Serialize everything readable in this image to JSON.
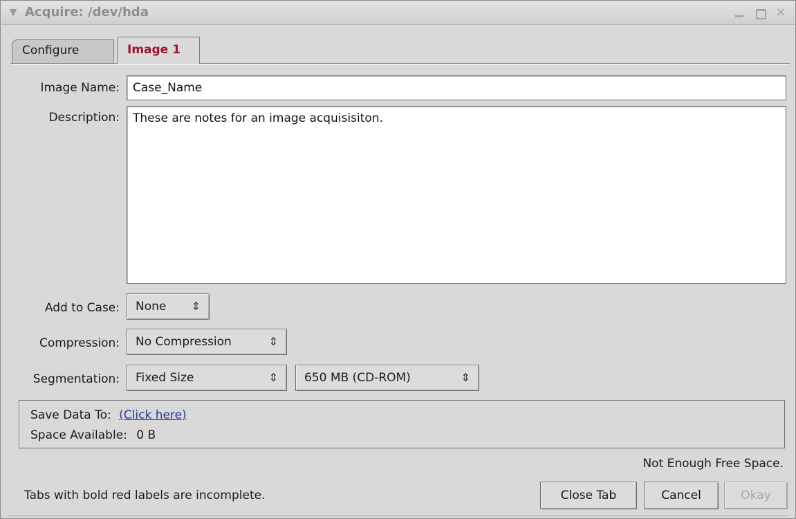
{
  "window": {
    "title": "Acquire: /dev/hda",
    "icons": {
      "menu": "chevron-down-icon",
      "minimize": "minimize-icon",
      "maximize": "maximize-icon",
      "close": "close-icon"
    },
    "close_glyph": "✕"
  },
  "tabs": [
    {
      "label": "Configure",
      "active": false
    },
    {
      "label": "Image 1",
      "active": true,
      "incomplete": true,
      "label_color": "#a0122a"
    }
  ],
  "form": {
    "image_name_label": "Image Name:",
    "image_name_value": "Case_Name",
    "description_label": "Description:",
    "description_value": "These are notes for an image acquisisiton.",
    "add_to_case_label": "Add to Case:",
    "add_to_case_value": "None",
    "compression_label": "Compression:",
    "compression_value": "No Compression",
    "segmentation_label": "Segmentation:",
    "segmentation_value": "Fixed Size",
    "segment_size_value": "650 MB (CD-ROM)",
    "select_arrow_glyph": "⇕"
  },
  "save": {
    "save_data_to_label": "Save Data To:",
    "save_link_text": "(Click here)",
    "space_available_label": "Space Available:",
    "space_available_value": "0 B"
  },
  "status": {
    "warning": "Not Enough Free Space.",
    "hint": "Tabs with bold red labels are incomplete."
  },
  "buttons": {
    "close_tab": "Close Tab",
    "cancel": "Cancel",
    "okay": "Okay",
    "okay_enabled": false
  }
}
